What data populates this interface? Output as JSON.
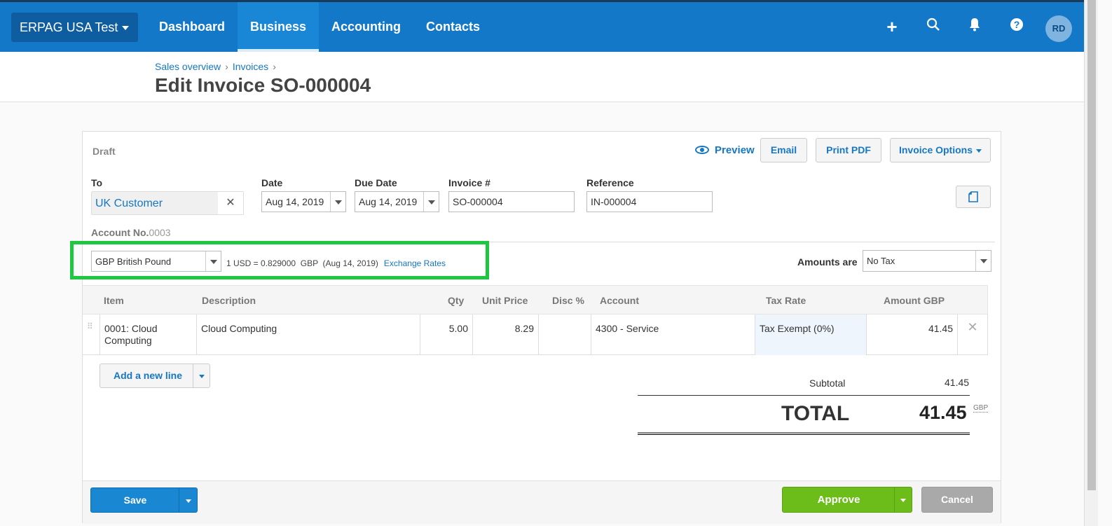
{
  "topbar": {
    "org_name": "ERPAG USA Test",
    "nav": [
      "Dashboard",
      "Business",
      "Accounting",
      "Contacts"
    ],
    "active_nav": "Business",
    "avatar_initials": "RD"
  },
  "breadcrumb": [
    "Sales overview",
    "Invoices"
  ],
  "page_title": "Edit Invoice SO-000004",
  "invoice": {
    "status": "Draft",
    "preview_label": "Preview",
    "email_label": "Email",
    "print_label": "Print PDF",
    "options_label": "Invoice Options",
    "to_label": "To",
    "to_value": "UK Customer",
    "date_label": "Date",
    "date_value": "Aug 14, 2019",
    "due_label": "Due Date",
    "due_value": "Aug 14, 2019",
    "number_label": "Invoice #",
    "number_value": "SO-000004",
    "reference_label": "Reference",
    "reference_value": "IN-000004",
    "account_label": "Account No.",
    "account_value": "0003",
    "currency": "GBP British Pound",
    "rate_text": "1 USD = 0.829000  GBP  (Aug 14, 2019)",
    "exchange_link": "Exchange Rates",
    "amounts_label": "Amounts are",
    "amounts_value": "No Tax"
  },
  "table": {
    "headers": [
      "Item",
      "Description",
      "Qty",
      "Unit Price",
      "Disc %",
      "Account",
      "Tax Rate",
      "Amount GBP"
    ],
    "rows": [
      {
        "item": "0001: Cloud Computing",
        "description": "Cloud Computing",
        "qty": "5.00",
        "unit_price": "8.29",
        "disc": "",
        "account": "4300 - Service",
        "tax_rate": "Tax Exempt (0%)",
        "amount": "41.45"
      }
    ]
  },
  "add_line_label": "Add a new line",
  "totals": {
    "subtotal_label": "Subtotal",
    "subtotal_value": "41.45",
    "total_label": "TOTAL",
    "total_value": "41.45",
    "currency": "GBP"
  },
  "footer": {
    "save_label": "Save",
    "approve_label": "Approve",
    "cancel_label": "Cancel"
  },
  "colors": {
    "topbar": "#1478c8",
    "highlight_box": "#1ec740",
    "approve": "#6cbd1a",
    "save": "#1a87d3"
  }
}
